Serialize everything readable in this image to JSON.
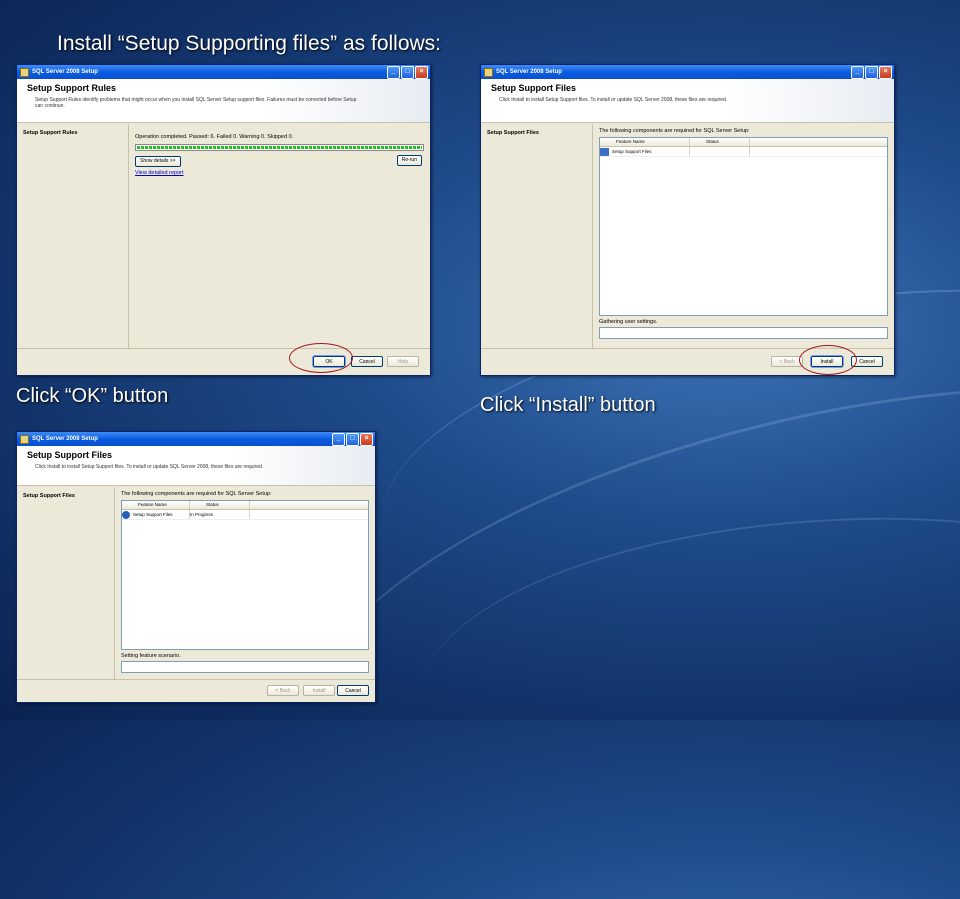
{
  "slide": {
    "title": "Install “Setup Supporting files” as follows:",
    "caption_ok": "Click “OK” button",
    "caption_install": "Click “Install” button"
  },
  "window1": {
    "title": "SQL Server 2008 Setup",
    "header_title": "Setup Support Rules",
    "header_desc": "Setup Support Rules identify problems that might occur when you install SQL Server Setup support files. Failures must be corrected before Setup can continue.",
    "side_item": "Setup Support Rules",
    "status_line": "Operation completed.  Passed: 6.   Failed 0.   Warning 0.   Skipped 0.",
    "progress": 1.0,
    "show_details": "Show details >>",
    "rerun": "Re-run",
    "view_report": "View detailed report",
    "ok": "OK",
    "cancel": "Cancel",
    "help": "Help"
  },
  "window2": {
    "title": "SQL Server 2008 Setup",
    "header_title": "Setup Support Files",
    "header_desc": "Click Install to install Setup Support files. To install or update SQL Server 2008, these files are required.",
    "side_item": "Setup Support Files",
    "components_label": "The following components are required for SQL Server Setup:",
    "col_feature": "Feature Name",
    "col_status": "Status",
    "row_feature": "Setup Support Files",
    "row_status": "",
    "gathering": "Gathering user settings.",
    "back": "< Back",
    "install": "Install",
    "cancel": "Cancel"
  },
  "window3": {
    "title": "SQL Server 2008 Setup",
    "header_title": "Setup Support Files",
    "header_desc": "Click Install to install Setup Support files. To install or update SQL Server 2008, these files are required.",
    "side_item": "Setup Support Files",
    "components_label": "The following components are required for SQL Server Setup:",
    "col_feature": "Feature Name",
    "col_status": "Status",
    "row_feature": "Setup Support Files",
    "row_status": "In Progress",
    "gathering": "Setting feature scenario.",
    "back": "< Back",
    "install": "Install",
    "cancel": "Cancel"
  },
  "colors": {
    "ring": "#a31a1a",
    "progress": "#25c125"
  },
  "icons": {
    "app": "sql-setup-icon",
    "minimize": "minimize-icon",
    "maximize": "maximize-icon",
    "close": "close-icon"
  }
}
